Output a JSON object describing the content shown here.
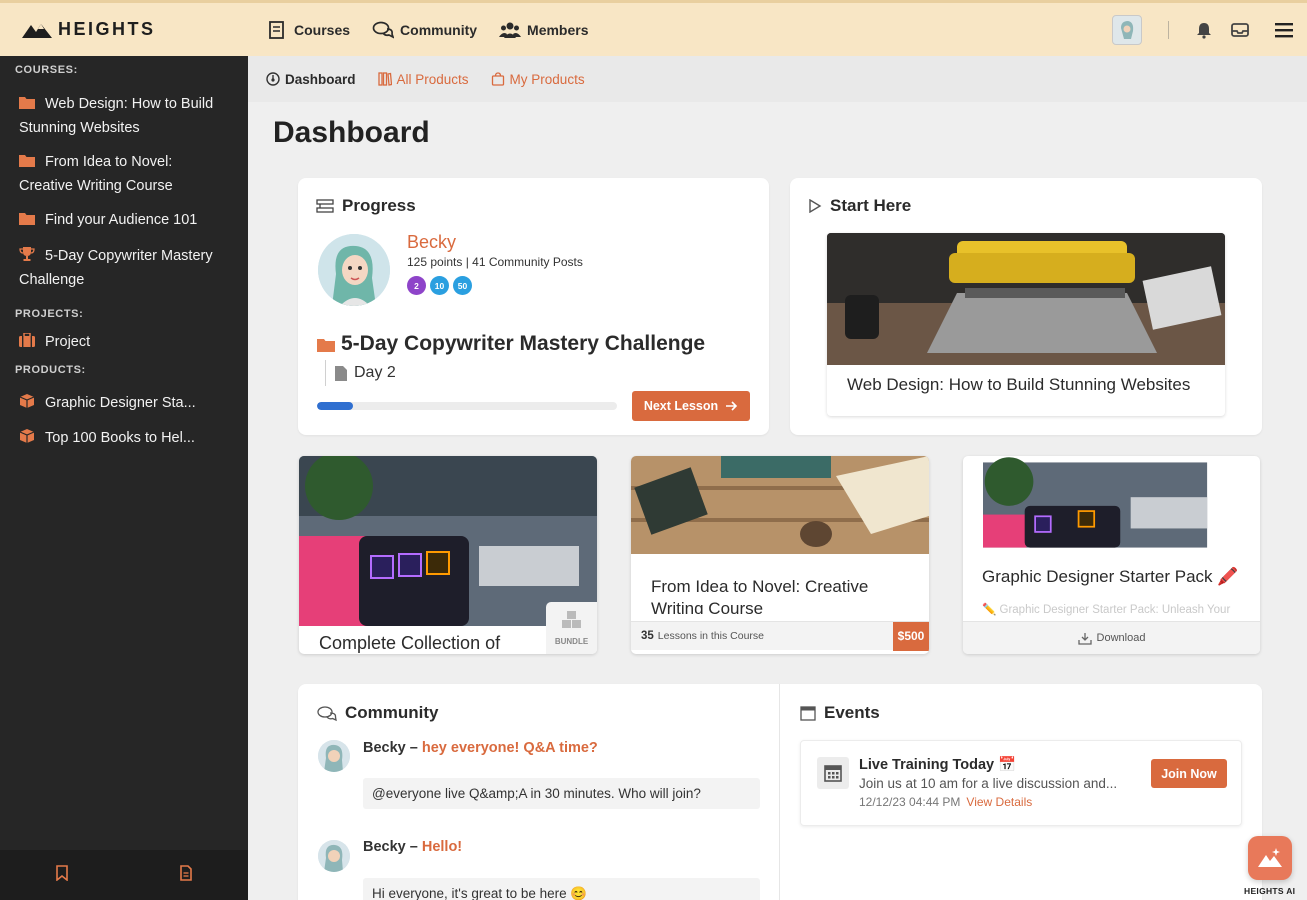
{
  "brand": {
    "name": "HEIGHTS"
  },
  "topnav": {
    "courses": "Courses",
    "community": "Community",
    "members": "Members"
  },
  "sidebar": {
    "courses_heading": "COURSES:",
    "projects_heading": "PROJECTS:",
    "products_heading": "PRODUCTS:",
    "courses": [
      {
        "label": "Web Design: How to Build Stunning Websites",
        "icon": "folder-icon"
      },
      {
        "label": "From Idea to Novel: Creative Writing Course",
        "icon": "folder-icon"
      },
      {
        "label": "Find your Audience 101",
        "icon": "folder-icon"
      },
      {
        "label": "5-Day Copywriter Mastery Challenge",
        "icon": "trophy-icon"
      }
    ],
    "projects": [
      {
        "label": "Project",
        "icon": "briefcase-icon"
      }
    ],
    "products": [
      {
        "label": "Graphic Designer Sta...",
        "icon": "box-icon"
      },
      {
        "label": "Top 100 Books to Hel...",
        "icon": "box-icon"
      }
    ]
  },
  "subnav": {
    "dashboard": "Dashboard",
    "all_products": "All Products",
    "my_products": "My Products"
  },
  "page": {
    "title": "Dashboard"
  },
  "progress": {
    "heading": "Progress",
    "user_name": "Becky",
    "user_stats": "125 points | 41 Community Posts",
    "badges": [
      "2",
      "10",
      "50"
    ],
    "course_title": "5-Day Copywriter Mastery Challenge",
    "day_label": "Day 2",
    "progress_fraction": 0.12,
    "next_button": "Next Lesson"
  },
  "start_here": {
    "heading": "Start Here",
    "course_title": "Web Design: How to Build Stunning Websites"
  },
  "products": [
    {
      "title": "Complete Collection of",
      "badge": "BUNDLE"
    },
    {
      "title": "From Idea to Novel: Creative Writing Course",
      "lessons_count": "35",
      "lessons_text": "Lessons in this Course",
      "price": "$500"
    },
    {
      "title": "Graphic Designer Starter Pack 🖍️",
      "subtitle": "✏️ Graphic Designer Starter Pack: Unleash Your",
      "action": "Download"
    }
  ],
  "community": {
    "heading": "Community",
    "posts": [
      {
        "author": "Becky",
        "title": "hey everyone! Q&A time?",
        "body": "@everyone live Q&amp;A in 30 minutes. Who will join?"
      },
      {
        "author": "Becky",
        "title": "Hello!",
        "body": "Hi everyone, it's great to be here 😊"
      }
    ]
  },
  "events": {
    "heading": "Events",
    "title": "Live Training Today 📅",
    "description": "Join us at 10 am for a live discussion and...",
    "date": "12/12/23 04:44 PM",
    "details_link": "View Details",
    "join_button": "Join Now"
  },
  "ai": {
    "label": "HEIGHTS AI"
  },
  "colors": {
    "accent": "#d96a3e",
    "topbar": "#f8e6c5",
    "sidebar": "#262626",
    "progress": "#2f6fd0"
  }
}
